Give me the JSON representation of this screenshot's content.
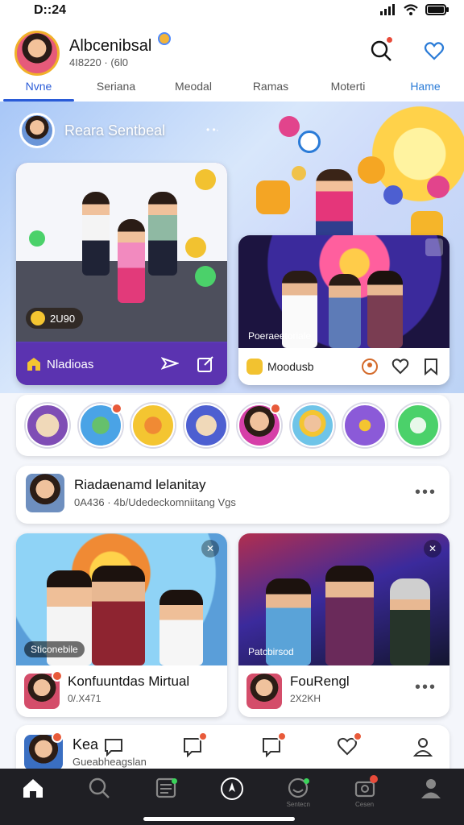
{
  "status": {
    "time": "D::24"
  },
  "profile": {
    "name": "Albcenibsal",
    "subtitle": "4I8220 · (6l0"
  },
  "tabs": [
    {
      "label": "Nvne"
    },
    {
      "label": "Seriana"
    },
    {
      "label": "Meodal"
    },
    {
      "label": "Ramas"
    },
    {
      "label": "Moterti"
    },
    {
      "label": "Hame"
    }
  ],
  "banner": {
    "title": "Reara Sentbeal",
    "dots": "• •·"
  },
  "cards": {
    "left": {
      "label": "Nladioas",
      "chip": "2U90"
    },
    "right": {
      "caption": "Poeraeetoriale",
      "label": "Moodusb"
    }
  },
  "post": {
    "title": "Riadaenamd lelanitay",
    "subtitle": "0A436 · 4b/Udedeckomniitang Vgs"
  },
  "feed": [
    {
      "caption": "Sticonebile",
      "title": "Konfuuntdas Mirtual",
      "meta": "0/.X471"
    },
    {
      "caption": "Patcbirsod",
      "title": "FouRengl",
      "meta": "2X2KH"
    }
  ],
  "mini": {
    "title": "Kea",
    "subtitle": "Gueabheagslan"
  },
  "nav": [
    {
      "icon": "home-icon"
    },
    {
      "icon": "search-icon"
    },
    {
      "icon": "feed-icon"
    },
    {
      "icon": "create-icon"
    },
    {
      "icon": "smiley-icon",
      "label": "Sentecn"
    },
    {
      "icon": "camera-icon",
      "label": "Cesen"
    },
    {
      "icon": "profile-icon"
    }
  ],
  "colors": {
    "accent": "#2a5bd7",
    "card_purple": "#5b33b0",
    "badge": "#e84b3a",
    "nav_bg": "#1f1f24"
  }
}
